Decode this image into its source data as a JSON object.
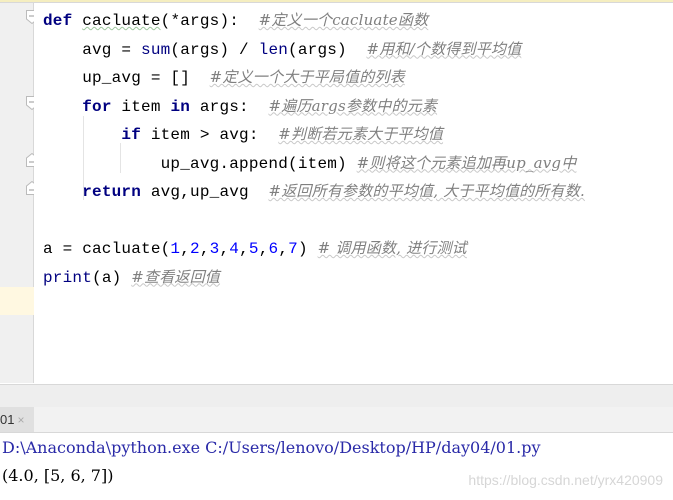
{
  "editor": {
    "lines": [
      {
        "tokens": [
          {
            "t": "def",
            "c": "kw"
          },
          {
            "t": " "
          },
          {
            "t": "cacluate",
            "c": "squig"
          },
          {
            "t": "(*args):  "
          },
          {
            "t": "#定义一个cacluate函数",
            "c": "cm"
          }
        ]
      },
      {
        "tokens": [
          {
            "t": "    avg = "
          },
          {
            "t": "sum",
            "c": "bi"
          },
          {
            "t": "(args) / "
          },
          {
            "t": "len",
            "c": "bi"
          },
          {
            "t": "(args)  "
          },
          {
            "t": "#用和/个数得到平均值",
            "c": "cm"
          }
        ]
      },
      {
        "tokens": [
          {
            "t": "    up_avg = []  "
          },
          {
            "t": "#定义一个大于平局值的列表",
            "c": "cm"
          }
        ]
      },
      {
        "tokens": [
          {
            "t": "    "
          },
          {
            "t": "for",
            "c": "kw"
          },
          {
            "t": " item "
          },
          {
            "t": "in",
            "c": "kw"
          },
          {
            "t": " args:  "
          },
          {
            "t": "#遍历args参数中的元素",
            "c": "cm"
          }
        ]
      },
      {
        "tokens": [
          {
            "t": "        "
          },
          {
            "t": "if",
            "c": "kw"
          },
          {
            "t": " item > avg:  "
          },
          {
            "t": "#判断若元素大于平均值",
            "c": "cm"
          }
        ]
      },
      {
        "tokens": [
          {
            "t": "            up_avg.append(item) "
          },
          {
            "t": "#则将这个元素追加再up_avg中",
            "c": "cm"
          }
        ]
      },
      {
        "tokens": [
          {
            "t": "    "
          },
          {
            "t": "return",
            "c": "kw"
          },
          {
            "t": " avg,up_avg  "
          },
          {
            "t": "#返回所有参数的平均值, 大于平均值的所有数.",
            "c": "cm"
          }
        ]
      },
      {
        "tokens": []
      },
      {
        "tokens": [
          {
            "t": "a = cacluate("
          },
          {
            "t": "1",
            "c": "num"
          },
          {
            "t": ","
          },
          {
            "t": "2",
            "c": "num"
          },
          {
            "t": ","
          },
          {
            "t": "3",
            "c": "num"
          },
          {
            "t": ","
          },
          {
            "t": "4",
            "c": "num"
          },
          {
            "t": ","
          },
          {
            "t": "5",
            "c": "num"
          },
          {
            "t": ","
          },
          {
            "t": "6",
            "c": "num"
          },
          {
            "t": ","
          },
          {
            "t": "7",
            "c": "num"
          },
          {
            "t": ") "
          },
          {
            "t": "# 调用函数, 进行测试",
            "c": "cm"
          }
        ]
      },
      {
        "tokens": [
          {
            "t": "print",
            "c": "bi"
          },
          {
            "t": "(a) "
          },
          {
            "t": "#查看返回值",
            "c": "cm"
          }
        ]
      }
    ]
  },
  "run_panel": {
    "tab_label": "01",
    "close_glyph": "×",
    "command": "D:\\Anaconda\\python.exe C:/Users/lenovo/Desktop/HP/day04/01.py",
    "output": "(4.0, [5, 6, 7])"
  },
  "watermark": "https://blog.csdn.net/yrx420909"
}
